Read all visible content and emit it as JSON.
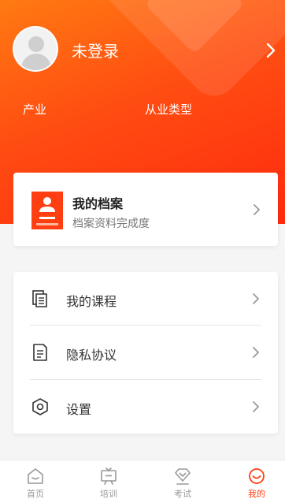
{
  "header": {
    "username": "未登录",
    "industry_label": "产业",
    "job_type_label": "从业类型"
  },
  "archive": {
    "title": "我的档案",
    "subtitle": "档案资料完成度",
    "icon": "document-profile-icon"
  },
  "menu": {
    "items": [
      {
        "label": "我的课程",
        "icon": "copy-document-icon"
      },
      {
        "label": "隐私协议",
        "icon": "document-icon"
      },
      {
        "label": "设置",
        "icon": "hexagon-settings-icon"
      }
    ]
  },
  "tabbar": {
    "tabs": [
      {
        "label": "首页",
        "icon": "home-icon"
      },
      {
        "label": "培训",
        "icon": "training-screen-icon"
      },
      {
        "label": "考试",
        "icon": "gem-exam-icon"
      },
      {
        "label": "我的",
        "icon": "smile-icon"
      }
    ],
    "active_index": 3
  },
  "colors": {
    "brand": "#ff3f12",
    "header_gradient_start": "#ff7a12",
    "header_gradient_end": "#ff2a0d"
  }
}
